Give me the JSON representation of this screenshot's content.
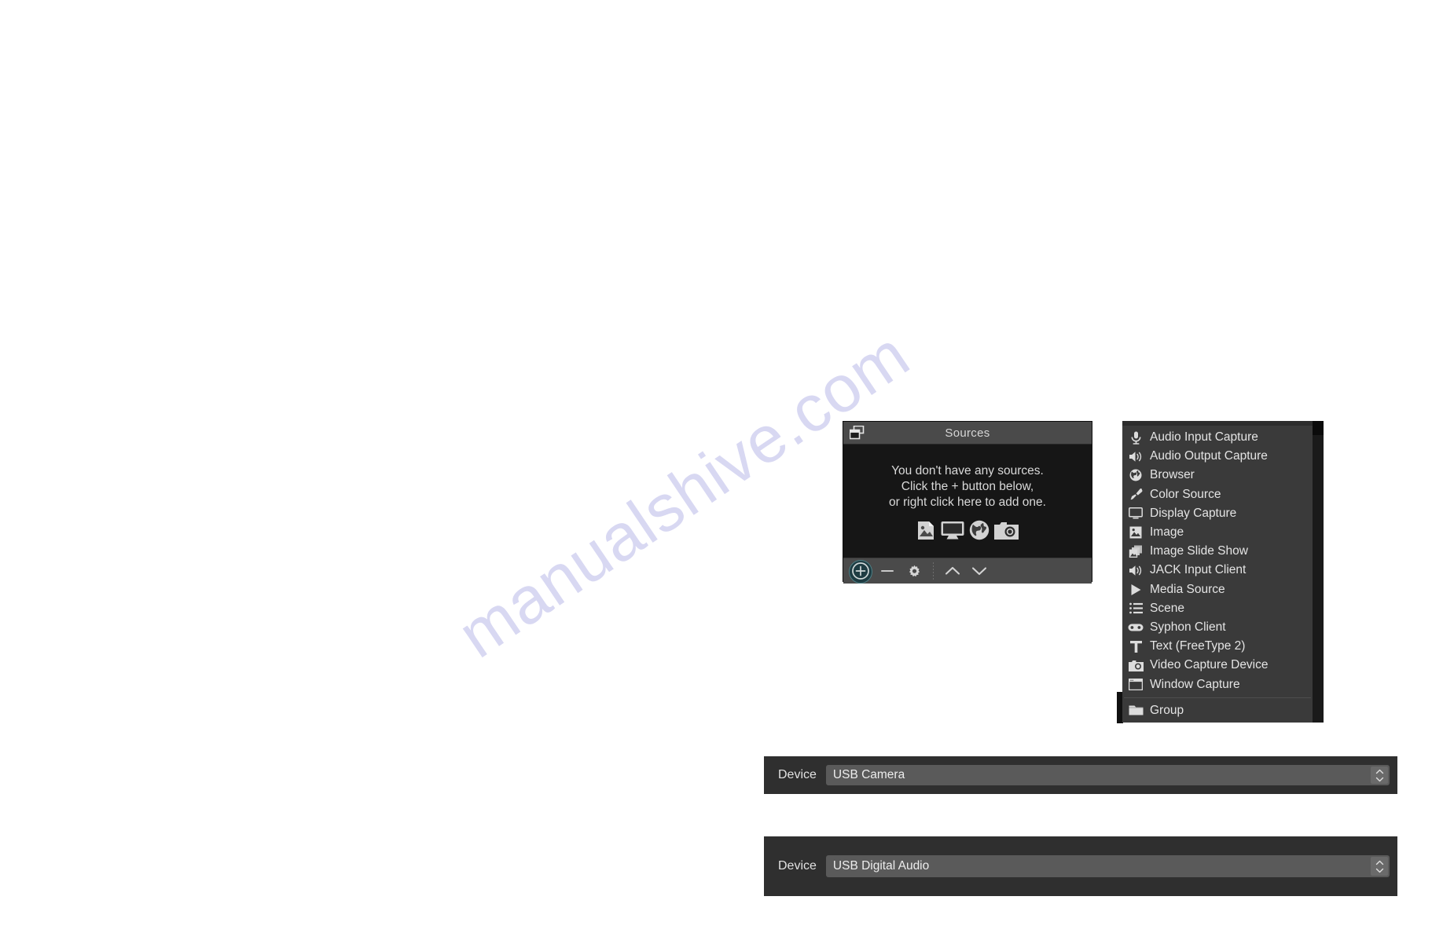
{
  "watermark": {
    "text": "manualshive.com",
    "color": "#d8d8f2"
  },
  "sources_panel": {
    "title": "Sources",
    "dock_icon": "windows-stack-icon",
    "empty_state": {
      "line1": "You don't have any sources.",
      "line2": "Click the + button below,",
      "line3": "or right click here to add one.",
      "icons": [
        "image-icon",
        "display-icon",
        "globe-icon",
        "camera-icon"
      ]
    },
    "toolbar": {
      "add_label": "+",
      "remove_label": "—",
      "properties_icon": "gear-icon",
      "move_up_icon": "chevron-up-icon",
      "move_down_icon": "chevron-down-icon",
      "add_focus_color": "#1e3c42"
    }
  },
  "source_menu": {
    "items": [
      {
        "label": "Audio Input Capture",
        "icon": "microphone-icon"
      },
      {
        "label": "Audio Output Capture",
        "icon": "speaker-icon"
      },
      {
        "label": "Browser",
        "icon": "globe-icon"
      },
      {
        "label": "Color Source",
        "icon": "brush-icon"
      },
      {
        "label": "Display Capture",
        "icon": "monitor-icon"
      },
      {
        "label": "Image",
        "icon": "image-icon"
      },
      {
        "label": "Image Slide Show",
        "icon": "image-stack-icon"
      },
      {
        "label": "JACK Input Client",
        "icon": "speaker-icon"
      },
      {
        "label": "Media Source",
        "icon": "play-icon"
      },
      {
        "label": "Scene",
        "icon": "list-icon"
      },
      {
        "label": "Syphon Client",
        "icon": "gamepad-icon"
      },
      {
        "label": "Text (FreeType 2)",
        "icon": "text-icon"
      },
      {
        "label": "Video Capture Device",
        "icon": "camera-icon"
      },
      {
        "label": "Window Capture",
        "icon": "window-icon"
      }
    ],
    "group_item": {
      "label": "Group",
      "icon": "folder-icon"
    }
  },
  "device_rows": [
    {
      "label": "Device",
      "value": "USB Camera"
    },
    {
      "label": "Device",
      "value": "USB Digital Audio"
    }
  ]
}
